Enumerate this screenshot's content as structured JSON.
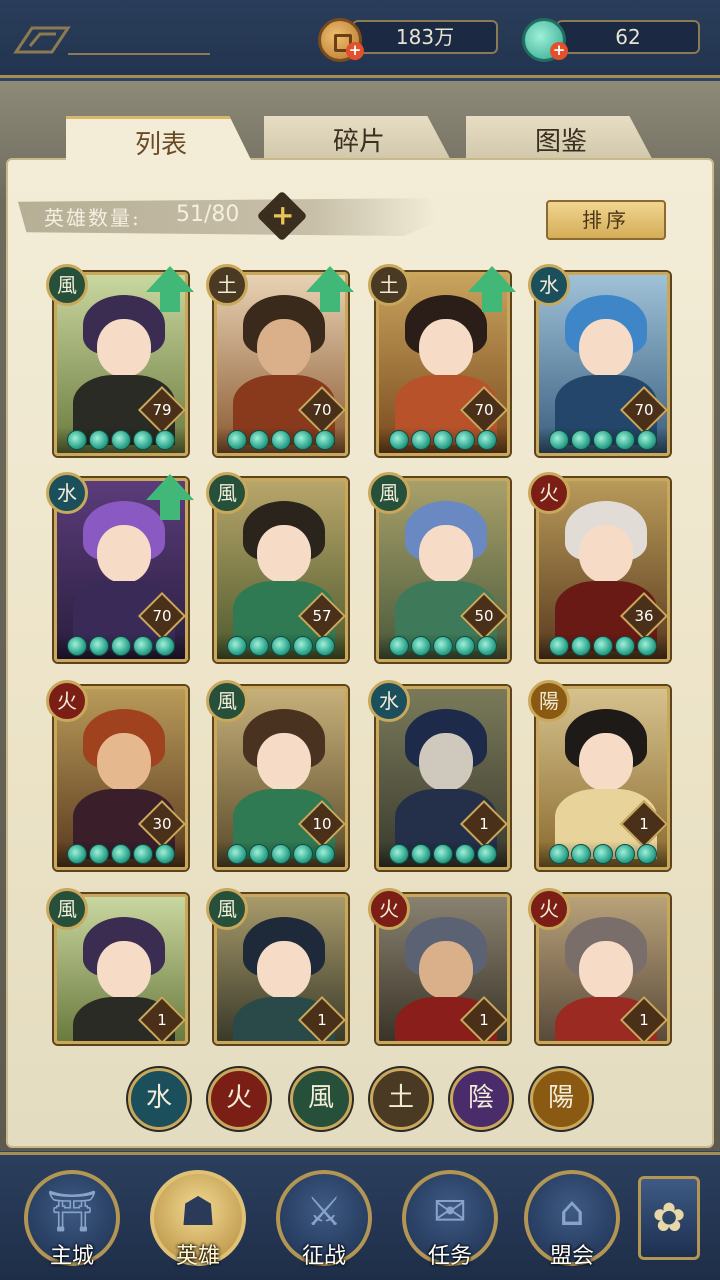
{
  "currency": {
    "coins": "183万",
    "jade": "62"
  },
  "tabs": [
    "列表",
    "碎片",
    "图鉴"
  ],
  "hero_count": {
    "label": "英雄数量:",
    "value": "51/80"
  },
  "sort_label": "排序",
  "heroes": [
    {
      "element": "風",
      "level": "79",
      "upgrade": true
    },
    {
      "element": "土",
      "level": "70",
      "upgrade": true
    },
    {
      "element": "土",
      "level": "70",
      "upgrade": true
    },
    {
      "element": "水",
      "level": "70",
      "upgrade": false
    },
    {
      "element": "水",
      "level": "70",
      "upgrade": true
    },
    {
      "element": "風",
      "level": "57",
      "upgrade": false
    },
    {
      "element": "風",
      "level": "50",
      "upgrade": false
    },
    {
      "element": "火",
      "level": "36",
      "upgrade": false
    },
    {
      "element": "火",
      "level": "30",
      "upgrade": false
    },
    {
      "element": "風",
      "level": "10",
      "upgrade": false
    },
    {
      "element": "水",
      "level": "1",
      "upgrade": false
    },
    {
      "element": "陽",
      "level": "1",
      "upgrade": false
    },
    {
      "element": "風",
      "level": "1",
      "upgrade": false
    },
    {
      "element": "風",
      "level": "1",
      "upgrade": false
    },
    {
      "element": "火",
      "level": "1",
      "upgrade": false
    },
    {
      "element": "火",
      "level": "1",
      "upgrade": false
    }
  ],
  "element_filters": [
    "水",
    "火",
    "風",
    "土",
    "陰",
    "陽"
  ],
  "nav": [
    {
      "label": "主城",
      "icon": "city-gate-icon"
    },
    {
      "label": "英雄",
      "icon": "hero-portrait-icon"
    },
    {
      "label": "征战",
      "icon": "battle-scroll-icon"
    },
    {
      "label": "任务",
      "icon": "task-bell-icon"
    },
    {
      "label": "盟会",
      "icon": "alliance-pavilion-icon"
    }
  ],
  "colors": {
    "panel": "#f3edd8",
    "gold_border": "#c9a85c",
    "navy": "#2f4362",
    "upgrade_arrow": "#41b778"
  }
}
